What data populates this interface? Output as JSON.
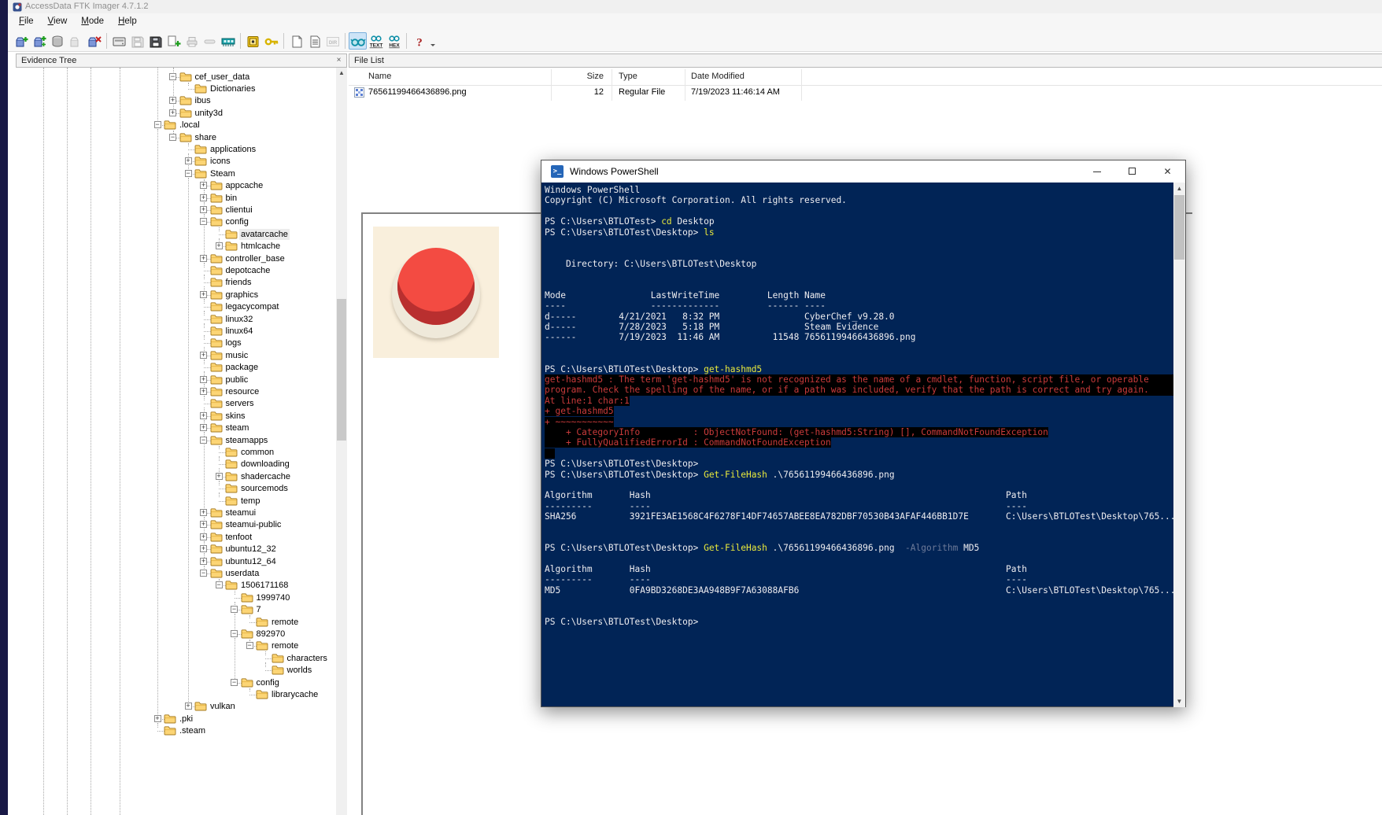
{
  "window": {
    "title": "AccessData FTK Imager 4.7.1.2"
  },
  "menu": {
    "items": [
      "File",
      "View",
      "Mode",
      "Help"
    ]
  },
  "toolbar": {
    "active": "auto-mode",
    "buttons": [
      "add-evidence-item",
      "add-all-attached-devices",
      "image-mounting",
      "archive-disabled",
      "remove-evidence-item",
      "|",
      "create-disk-image",
      "save-disabled",
      "export-disk-image",
      "add-to-custom-content-image",
      "print-disabled",
      "export-disabled",
      "capture-memory",
      "|",
      "obtain-protected-files",
      "detect-encryption",
      "|",
      "new-window",
      "properties",
      "directory-listing-disabled",
      "|",
      "auto-mode",
      "text-mode",
      "hex-mode",
      "|",
      "help",
      "overflow"
    ]
  },
  "evidence_tree": {
    "title": "Evidence Tree",
    "close_glyph": "×",
    "items": [
      [
        "cef_user_data",
        1,
        "m",
        0
      ],
      [
        "Dictionaries",
        2,
        "n",
        0
      ],
      [
        "ibus",
        1,
        "p",
        0
      ],
      [
        "unity3d",
        1,
        "p",
        0
      ],
      [
        ".local",
        0,
        "m",
        0
      ],
      [
        "share",
        1,
        "m",
        0
      ],
      [
        "applications",
        2,
        "n",
        0
      ],
      [
        "icons",
        2,
        "p",
        0
      ],
      [
        "Steam",
        2,
        "m",
        0
      ],
      [
        "appcache",
        3,
        "p",
        0
      ],
      [
        "bin",
        3,
        "p",
        0
      ],
      [
        "clientui",
        3,
        "p",
        0
      ],
      [
        "config",
        3,
        "m",
        0
      ],
      [
        "avatarcache",
        4,
        "n",
        1
      ],
      [
        "htmlcache",
        4,
        "p",
        0
      ],
      [
        "controller_base",
        3,
        "p",
        0
      ],
      [
        "depotcache",
        3,
        "n",
        0
      ],
      [
        "friends",
        3,
        "n",
        0
      ],
      [
        "graphics",
        3,
        "p",
        0
      ],
      [
        "legacycompat",
        3,
        "n",
        0
      ],
      [
        "linux32",
        3,
        "n",
        0
      ],
      [
        "linux64",
        3,
        "n",
        0
      ],
      [
        "logs",
        3,
        "n",
        0
      ],
      [
        "music",
        3,
        "p",
        0
      ],
      [
        "package",
        3,
        "n",
        0
      ],
      [
        "public",
        3,
        "p",
        0
      ],
      [
        "resource",
        3,
        "p",
        0
      ],
      [
        "servers",
        3,
        "n",
        0
      ],
      [
        "skins",
        3,
        "p",
        0
      ],
      [
        "steam",
        3,
        "p",
        0
      ],
      [
        "steamapps",
        3,
        "m",
        0
      ],
      [
        "common",
        4,
        "n",
        0
      ],
      [
        "downloading",
        4,
        "n",
        0
      ],
      [
        "shadercache",
        4,
        "p",
        0
      ],
      [
        "sourcemods",
        4,
        "n",
        0
      ],
      [
        "temp",
        4,
        "n",
        0
      ],
      [
        "steamui",
        3,
        "p",
        0
      ],
      [
        "steamui-public",
        3,
        "p",
        0
      ],
      [
        "tenfoot",
        3,
        "p",
        0
      ],
      [
        "ubuntu12_32",
        3,
        "p",
        0
      ],
      [
        "ubuntu12_64",
        3,
        "p",
        0
      ],
      [
        "userdata",
        3,
        "m",
        0
      ],
      [
        "1506171168",
        4,
        "m",
        0
      ],
      [
        "1999740",
        5,
        "n",
        0
      ],
      [
        "7",
        5,
        "m",
        0
      ],
      [
        "remote",
        6,
        "n",
        0
      ],
      [
        "892970",
        5,
        "m",
        0
      ],
      [
        "remote",
        6,
        "m",
        0
      ],
      [
        "characters",
        7,
        "n",
        0
      ],
      [
        "worlds",
        7,
        "n",
        0
      ],
      [
        "config",
        5,
        "m",
        0
      ],
      [
        "librarycache",
        6,
        "n",
        0
      ],
      [
        "vulkan",
        2,
        "p",
        0
      ],
      [
        ".pki",
        0,
        "p",
        0
      ],
      [
        ".steam",
        0,
        "n",
        0
      ]
    ]
  },
  "file_list": {
    "title": "File List",
    "columns": [
      "Name",
      "Size",
      "Type",
      "Date Modified"
    ],
    "rows": [
      {
        "name": "76561199466436896.png",
        "size": "12",
        "type": "Regular File",
        "date_modified": "7/19/2023 11:46:14 AM"
      }
    ]
  },
  "preview": {
    "background_color": "#f9efdc",
    "button_color": "#f34b42",
    "button_shade_color": "#b92f2f",
    "ring_color": "#efe9da"
  },
  "powershell": {
    "title": "Windows PowerShell",
    "colors": {
      "background": "#012456",
      "foreground": "#eeedf0",
      "command": "#e9e93c",
      "error": "#c93b3b",
      "parameter": "#6d7a99"
    },
    "lines": [
      {
        "s": [
          [
            "",
            "Windows PowerShell"
          ]
        ]
      },
      {
        "s": [
          [
            "",
            "Copyright (C) Microsoft Corporation. All rights reserved."
          ]
        ]
      },
      {
        "s": []
      },
      {
        "s": [
          [
            "",
            "PS C:\\Users\\BTLOTest> "
          ],
          [
            "y",
            "cd"
          ],
          [
            "",
            " Desktop"
          ]
        ]
      },
      {
        "s": [
          [
            "",
            "PS C:\\Users\\BTLOTest\\Desktop> "
          ],
          [
            "y",
            "ls"
          ]
        ]
      },
      {
        "s": []
      },
      {
        "s": []
      },
      {
        "s": [
          [
            "",
            "    Directory: C:\\Users\\BTLOTest\\Desktop"
          ]
        ]
      },
      {
        "s": []
      },
      {
        "s": []
      },
      {
        "s": [
          [
            "",
            "Mode                LastWriteTime         Length Name"
          ]
        ]
      },
      {
        "s": [
          [
            "",
            "----                -------------         ------ ----"
          ]
        ]
      },
      {
        "s": [
          [
            "",
            "d-----        4/21/2021   8:32 PM                CyberChef_v9.28.0"
          ]
        ]
      },
      {
        "s": [
          [
            "",
            "d-----        7/28/2023   5:18 PM                Steam Evidence"
          ]
        ]
      },
      {
        "s": [
          [
            "",
            "------        7/19/2023  11:46 AM          11548 76561199466436896.png"
          ]
        ]
      },
      {
        "s": []
      },
      {
        "s": []
      },
      {
        "s": [
          [
            "",
            "PS C:\\Users\\BTLOTest\\Desktop> "
          ],
          [
            "y",
            "get-hashmd5"
          ]
        ]
      },
      {
        "s": [
          [
            "e",
            "get-hashmd5 : The term 'get-hashmd5' is not recognized as the name of a cmdlet, function, script file, or operable"
          ]
        ],
        "f": 1
      },
      {
        "s": [
          [
            "e",
            "program. Check the spelling of the name, or if a path was included, verify that the path is correct and try again."
          ]
        ],
        "f": 1
      },
      {
        "s": [
          [
            "e",
            "At line:1 char:1"
          ]
        ]
      },
      {
        "s": [
          [
            "e",
            "+ get-hashmd5"
          ]
        ]
      },
      {
        "s": [
          [
            "e",
            "+ ~~~~~~~~~~~"
          ]
        ]
      },
      {
        "s": [
          [
            "e",
            "    + CategoryInfo          : ObjectNotFound: (get-hashmd5:String) [], CommandNotFoundException"
          ]
        ]
      },
      {
        "s": [
          [
            "e",
            "    + FullyQualifiedErrorId : CommandNotFoundException"
          ]
        ]
      },
      {
        "s": [
          [
            "e",
            "  "
          ]
        ]
      },
      {
        "s": [
          [
            "",
            "PS C:\\Users\\BTLOTest\\Desktop> "
          ]
        ]
      },
      {
        "s": [
          [
            "",
            "PS C:\\Users\\BTLOTest\\Desktop> "
          ],
          [
            "y",
            "Get-FileHash"
          ],
          [
            "",
            " .\\76561199466436896.png"
          ]
        ]
      },
      {
        "s": []
      },
      {
        "s": [
          [
            "",
            "Algorithm       Hash                                                                   Path"
          ]
        ]
      },
      {
        "s": [
          [
            "",
            "---------       ----                                                                   ----"
          ]
        ]
      },
      {
        "s": [
          [
            "",
            "SHA256          3921FE3AE1568C4F6278F14DF74657ABEE8EA782DBF70530B43AFAF446BB1D7E       C:\\Users\\BTLOTest\\Desktop\\765..."
          ]
        ]
      },
      {
        "s": []
      },
      {
        "s": []
      },
      {
        "s": [
          [
            "",
            "PS C:\\Users\\BTLOTest\\Desktop> "
          ],
          [
            "y",
            "Get-FileHash"
          ],
          [
            "",
            " .\\76561199466436896.png  "
          ],
          [
            "p",
            "-Algorithm"
          ],
          [
            "",
            " MD5"
          ]
        ]
      },
      {
        "s": []
      },
      {
        "s": [
          [
            "",
            "Algorithm       Hash                                                                   Path"
          ]
        ]
      },
      {
        "s": [
          [
            "",
            "---------       ----                                                                   ----"
          ]
        ]
      },
      {
        "s": [
          [
            "",
            "MD5             0FA9BD3268DE3AA948B9F7A63088AFB6                                       C:\\Users\\BTLOTest\\Desktop\\765..."
          ]
        ]
      },
      {
        "s": []
      },
      {
        "s": []
      },
      {
        "s": [
          [
            "",
            "PS C:\\Users\\BTLOTest\\Desktop> "
          ]
        ]
      }
    ]
  }
}
